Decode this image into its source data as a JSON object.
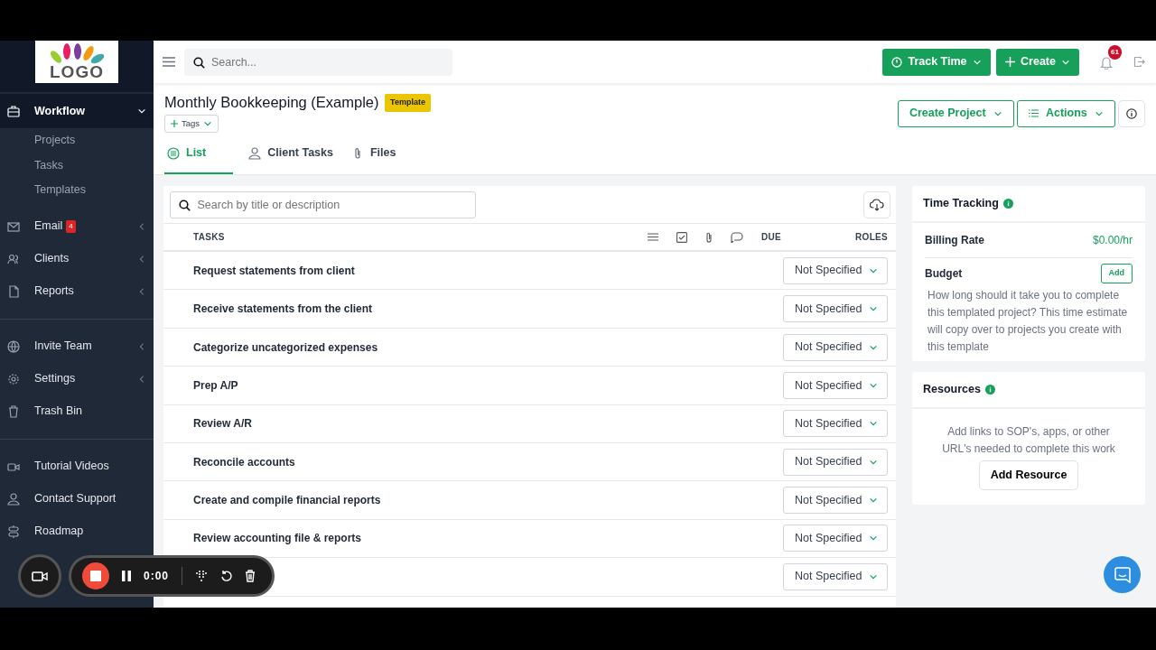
{
  "logo": "LOGO",
  "sidebar": {
    "sections": [
      {
        "items": [
          {
            "label": "Workflow",
            "kind": "group",
            "expanded": true,
            "children": [
              {
                "label": "Projects"
              },
              {
                "label": "Tasks"
              },
              {
                "label": "Templates"
              }
            ]
          },
          {
            "label": "Email",
            "kind": "group",
            "expanded": false,
            "badge": "4"
          },
          {
            "label": "Clients",
            "kind": "group",
            "expanded": false
          },
          {
            "label": "Reports",
            "kind": "group",
            "expanded": false
          }
        ]
      },
      {
        "items": [
          {
            "label": "Invite Team",
            "kind": "group",
            "expanded": false
          },
          {
            "label": "Settings",
            "kind": "group",
            "expanded": false
          },
          {
            "label": "Trash Bin",
            "kind": "link"
          }
        ]
      },
      {
        "items": [
          {
            "label": "Tutorial Videos",
            "kind": "link"
          },
          {
            "label": "Contact Support",
            "kind": "link"
          },
          {
            "label": "Roadmap",
            "kind": "link"
          }
        ]
      }
    ]
  },
  "topbar": {
    "search": {
      "placeholder": "Search..."
    },
    "buttons": [
      "Track Time",
      "Create"
    ],
    "notifications": "61"
  },
  "header": {
    "title": "Monthly Bookkeeping (Example)",
    "badge": "Template",
    "tags_button": "Tags",
    "actions": [
      "Create Project",
      "Actions"
    ],
    "tabs": [
      {
        "label": "List",
        "selected": true
      },
      {
        "label": "Client Tasks",
        "selected": false
      },
      {
        "label": "Files",
        "selected": false
      }
    ]
  },
  "task_list": {
    "search": {
      "placeholder": "Search by title or description"
    },
    "columns": [
      "TASKS",
      "DUE",
      "ROLES"
    ],
    "rows": [
      {
        "title": "Request statements from client",
        "role": "Not Specified"
      },
      {
        "title": "Receive statements from the client",
        "role": "Not Specified"
      },
      {
        "title": "Categorize uncategorized expenses",
        "role": "Not Specified"
      },
      {
        "title": "Prep A/P",
        "role": "Not Specified"
      },
      {
        "title": "Review A/R",
        "role": "Not Specified"
      },
      {
        "title": "Reconcile accounts",
        "role": "Not Specified"
      },
      {
        "title": "Create and compile financial reports",
        "role": "Not Specified"
      },
      {
        "title": "Review accounting file & reports",
        "role": "Not Specified"
      },
      {
        "role": "Not Specified"
      }
    ]
  },
  "time_tracking": {
    "title": "Time Tracking",
    "billing_label": "Billing Rate",
    "billing_value": "$0.00/hr",
    "budget_label": "Budget",
    "budget_button": "Add",
    "budget_text": "How long should it take you to complete this templated project? This time estimate will copy over to projects you create with this template"
  },
  "resources": {
    "title": "Resources",
    "text": "Add links to SOP's, apps, or other URL's needed to complete this work",
    "button": "Add Resource"
  },
  "recorder": {
    "time": "0:00"
  }
}
